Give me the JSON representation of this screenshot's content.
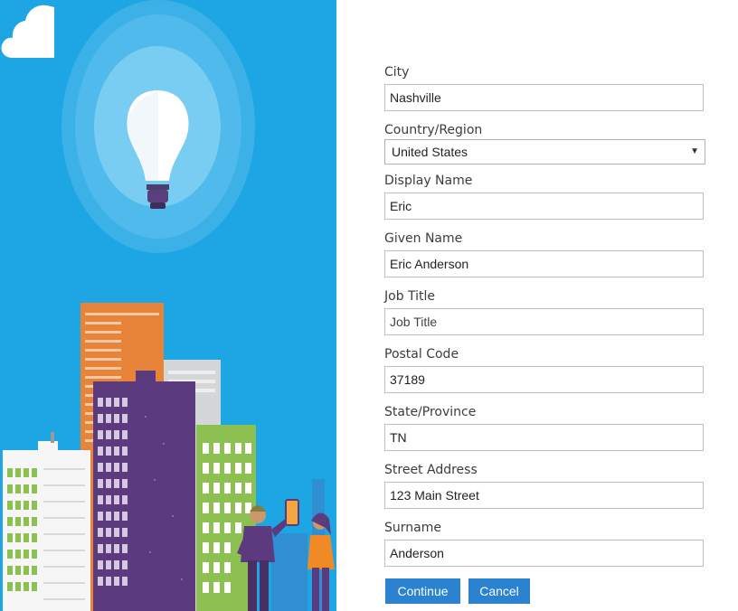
{
  "form": {
    "fields": [
      {
        "label": "City",
        "value": "Nashville",
        "placeholder": ""
      },
      {
        "label": "Display Name",
        "value": "Eric",
        "placeholder": ""
      },
      {
        "label": "Given Name",
        "value": "Eric Anderson",
        "placeholder": ""
      },
      {
        "label": "Job Title",
        "value": "",
        "placeholder": "Job Title"
      },
      {
        "label": "Postal Code",
        "value": "37189",
        "placeholder": ""
      },
      {
        "label": "State/Province",
        "value": "TN",
        "placeholder": ""
      },
      {
        "label": "Street Address",
        "value": "123 Main Street",
        "placeholder": ""
      },
      {
        "label": "Surname",
        "value": "Anderson",
        "placeholder": ""
      }
    ],
    "country": {
      "label": "Country/Region",
      "selected": "United States",
      "arrow": "▼"
    }
  },
  "buttons": {
    "continue": "Continue",
    "cancel": "Cancel"
  },
  "illustration": {
    "icons": [
      "lightbulb-icon",
      "cloud-icon",
      "buildings",
      "person-figures"
    ],
    "colors": {
      "sky": "#1ea6e4",
      "accent": "#2b82d0"
    }
  }
}
